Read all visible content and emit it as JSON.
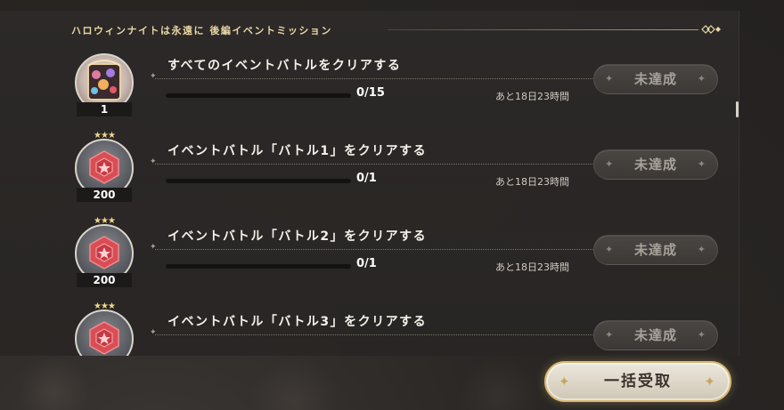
{
  "header": {
    "title": "ハロウィンナイトは永遠に 後編イベントミッション",
    "ornament_icon": "diamond-knot-ornament"
  },
  "colors": {
    "accent_gold": "#e8d6a4",
    "status_text": "#a8a39b",
    "ruby": "#d94d55"
  },
  "missions": [
    {
      "title": "すべてのイベントバトルをクリアする",
      "reward": {
        "type": "item",
        "icon": "halloween-frame-item-icon",
        "quantity": "1",
        "stars": 0
      },
      "progress_text": "0/15",
      "progress": 0,
      "time_left": "あと18日23時間",
      "status": "未達成"
    },
    {
      "title": "イベントバトル「バトル1」をクリアする",
      "reward": {
        "type": "gem",
        "icon": "ruby-gem-icon",
        "quantity": "200",
        "stars": 3
      },
      "progress_text": "0/1",
      "progress": 0,
      "time_left": "あと18日23時間",
      "status": "未達成"
    },
    {
      "title": "イベントバトル「バトル2」をクリアする",
      "reward": {
        "type": "gem",
        "icon": "ruby-gem-icon",
        "quantity": "200",
        "stars": 3
      },
      "progress_text": "0/1",
      "progress": 0,
      "time_left": "あと18日23時間",
      "status": "未達成"
    },
    {
      "title": "イベントバトル「バトル3」をクリアする",
      "reward": {
        "type": "gem",
        "icon": "ruby-gem-icon",
        "quantity": "",
        "stars": 3
      },
      "status": "未達成"
    }
  ],
  "claim_all_label": "一括受取"
}
